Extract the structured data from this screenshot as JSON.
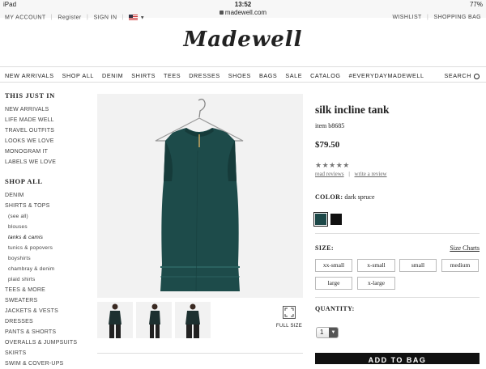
{
  "status": {
    "device": "iPad",
    "time": "13:52",
    "battery": "77%"
  },
  "url": "madewell.com",
  "topbar": {
    "my_account": "MY ACCOUNT",
    "register": "Register",
    "sign_in": "SIGN IN",
    "wishlist": "WISHLIST",
    "shopping_bag": "SHOPPING BAG"
  },
  "logo": "Madewell",
  "nav": {
    "items": [
      "NEW ARRIVALS",
      "SHOP ALL",
      "DENIM",
      "SHIRTS",
      "TEES",
      "DRESSES",
      "SHOES",
      "BAGS",
      "SALE",
      "CATALOG",
      "#EVERYDAYMADEWELL"
    ],
    "search": "SEARCH"
  },
  "sidebar": {
    "just_in_title": "THIS JUST IN",
    "just_in": [
      "NEW ARRIVALS",
      "LIFE MADE WELL",
      "TRAVEL OUTFITS",
      "LOOKS WE LOVE",
      "MONOGRAM IT",
      "LABELS WE LOVE"
    ],
    "shop_all_title": "SHOP ALL",
    "shop_all": [
      "DENIM",
      "SHIRTS & TOPS"
    ],
    "sub": [
      "(see all)",
      "blouses",
      "tanks & camis",
      "tunics & popovers",
      "boyshirts",
      "chambray & denim",
      "plaid shirts"
    ],
    "more": [
      "TEES & MORE",
      "SWEATERS",
      "JACKETS & VESTS",
      "DRESSES",
      "PANTS & SHORTS",
      "OVERALLS & JUMPSUITS",
      "SKIRTS",
      "SWIM & COVER-UPS"
    ]
  },
  "product": {
    "name": "silk incline tank",
    "item": "item b8685",
    "price": "$79.50",
    "rating": "★★★★★",
    "read_reviews": "read reviews",
    "write_review": "write a review",
    "color_label": "COLOR:",
    "color_value": "dark spruce",
    "swatch_colors": [
      "#1c4848",
      "#111111"
    ],
    "size_label": "SIZE:",
    "size_charts": "Size Charts",
    "sizes": [
      "xx-small",
      "x-small",
      "small",
      "medium",
      "large",
      "x-large"
    ],
    "quantity_label": "QUANTITY:",
    "quantity": "1",
    "add_to_bag": "ADD TO BAG",
    "full_size": "FULL SIZE"
  }
}
